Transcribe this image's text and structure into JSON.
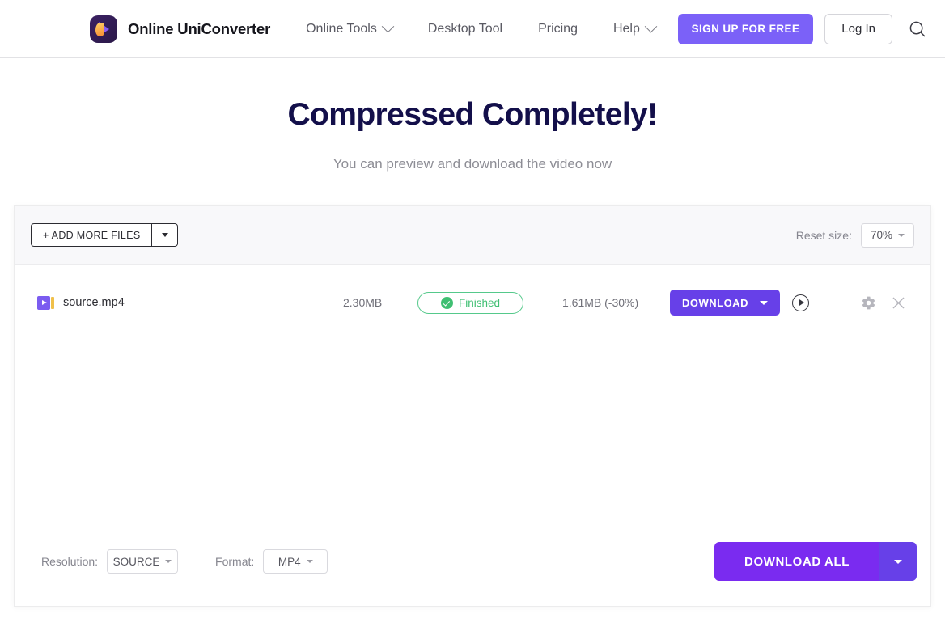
{
  "header": {
    "brand_name": "Online UniConverter",
    "logo_icon": "uniconverter-logo-icon",
    "nav": [
      {
        "label": "Online Tools",
        "has_caret": true
      },
      {
        "label": "Desktop Tool",
        "has_caret": false
      },
      {
        "label": "Pricing",
        "has_caret": false
      },
      {
        "label": "Help",
        "has_caret": true
      }
    ],
    "signup_label": "SIGN UP FOR FREE",
    "login_label": "Log In",
    "search_icon": "search-icon",
    "accent_color": "#7b61f8"
  },
  "hero": {
    "title": "Compressed Completely!",
    "subtitle": "You can preview and download the video now",
    "title_color": "#130f4a"
  },
  "toolbar": {
    "add_files_label": "+ ADD MORE FILES",
    "add_files_caret_icon": "chevron-down-icon",
    "reset_size_label": "Reset size:",
    "reset_size_value": "70%",
    "reset_size_caret_icon": "chevron-down-icon"
  },
  "file_row": {
    "file_icon": "video-file-icon",
    "file_name": "source.mp4",
    "original_size": "2.30MB",
    "status": "Finished",
    "status_icon": "check-circle-icon",
    "status_color": "#3fbf72",
    "compressed_size": "1.61MB (-30%)",
    "download_label": "DOWNLOAD",
    "download_caret_icon": "chevron-down-icon",
    "preview_icon": "play-circle-icon",
    "settings_icon": "gear-icon",
    "remove_icon": "close-icon",
    "download_color": "#6740e8"
  },
  "footer": {
    "resolution_label": "Resolution:",
    "resolution_value": "SOURCE",
    "resolution_caret_icon": "chevron-down-icon",
    "format_label": "Format:",
    "format_value": "MP4",
    "format_caret_icon": "chevron-down-icon",
    "download_all_label": "DOWNLOAD ALL",
    "download_all_caret_icon": "chevron-down-icon",
    "download_all_color": "#7a2bf0"
  }
}
